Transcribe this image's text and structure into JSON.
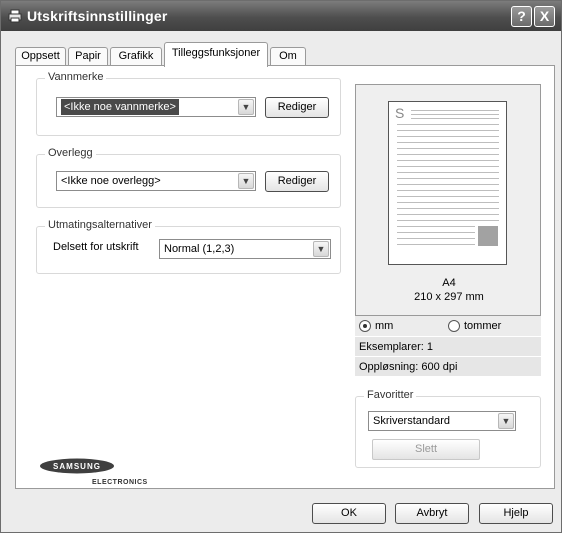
{
  "window": {
    "title": "Utskriftsinnstillinger",
    "help_btn": "?",
    "close_btn": "X"
  },
  "tabs": [
    {
      "label": "Oppsett"
    },
    {
      "label": "Papir"
    },
    {
      "label": "Grafikk"
    },
    {
      "label": "Tilleggsfunksjoner"
    },
    {
      "label": "Om"
    }
  ],
  "active_tab": "Tilleggsfunksjoner",
  "watermark": {
    "group_title": "Vannmerke",
    "value": "<Ikke noe vannmerke>",
    "edit_label": "Rediger"
  },
  "overlay": {
    "group_title": "Overlegg",
    "value": "<Ikke noe overlegg>",
    "edit_label": "Rediger"
  },
  "output": {
    "group_title": "Utmatingsalternativer",
    "label": "Delsett for utskrift",
    "value": "Normal (1,2,3)"
  },
  "preview": {
    "page_letter": "S",
    "paper_name": "A4",
    "paper_size": "210 x 297 mm",
    "unit_mm": "mm",
    "unit_inch": "tommer",
    "selected_unit": "mm",
    "copies": "Eksemplarer: 1",
    "resolution": "Oppløsning: 600 dpi"
  },
  "favorites": {
    "group_title": "Favoritter",
    "value": "Skriverstandard",
    "delete_label": "Slett"
  },
  "brand": {
    "name": "SAMSUNG",
    "sub": "ELECTRONICS"
  },
  "footer": {
    "ok_label": "OK",
    "cancel_label": "Avbryt",
    "help_label": "Hjelp"
  }
}
